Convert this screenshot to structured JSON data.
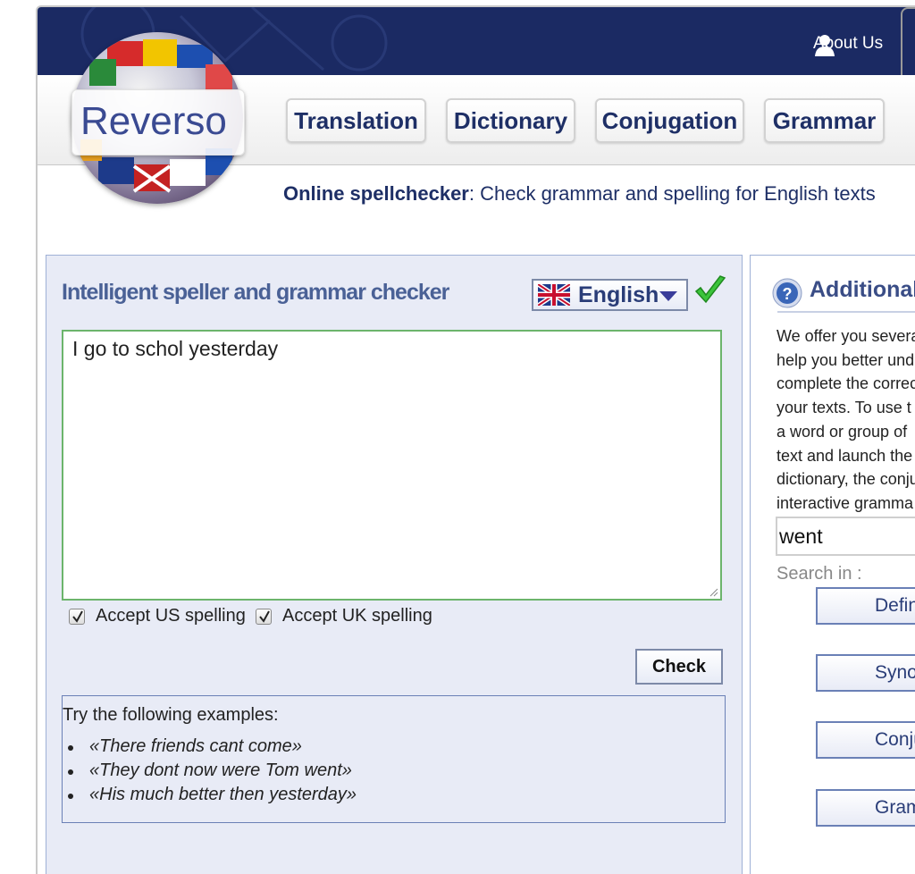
{
  "header": {
    "about_label": "About Us"
  },
  "logo": {
    "text": "Reverso"
  },
  "nav": {
    "items": [
      {
        "label": "Translation"
      },
      {
        "label": "Dictionary"
      },
      {
        "label": "Conjugation"
      },
      {
        "label": "Grammar"
      }
    ]
  },
  "subtitle": {
    "bold": "Online spellchecker",
    "rest": ": Check grammar and spelling for English texts"
  },
  "checker": {
    "title": "Intelligent speller and grammar checker",
    "language": "English",
    "text_value": "I go to schol yesterday",
    "accept_us": "Accept US spelling",
    "accept_uk": "Accept UK spelling",
    "accept_us_checked": true,
    "accept_uk_checked": true,
    "check_label": "Check"
  },
  "examples": {
    "title": "Try the following examples:",
    "items": [
      "«There friends cant come»",
      "«They dont now were Tom went»",
      "«His much better then yesterday»"
    ]
  },
  "additional": {
    "title": "Additional",
    "description_lines": [
      "We offer you severa",
      "help you better und",
      "complete the correc",
      "your texts. To use t",
      "a word or group of",
      "text and launch the",
      "dictionary, the conju",
      "interactive gramma"
    ],
    "word_value": "went",
    "search_in": "Search in :",
    "buttons": [
      "Defin",
      "Syno",
      "Conju",
      "Gram"
    ]
  },
  "colors": {
    "header_bg": "#1b2a63",
    "nav_text": "#1e2f66",
    "panel_bg": "#e8ebf6",
    "title_blue": "#4a6196",
    "check_green": "#3cc43c"
  }
}
